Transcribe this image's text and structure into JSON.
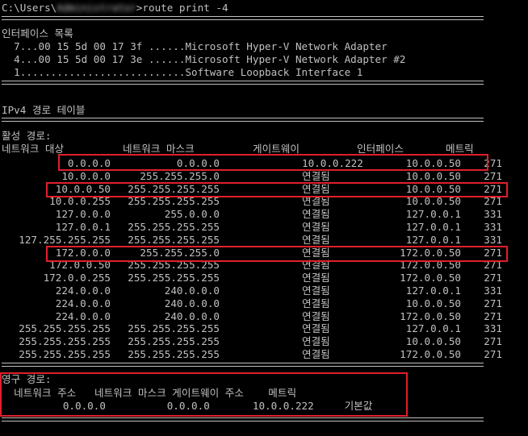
{
  "prompt": {
    "path_prefix": "C:\\Users\\",
    "username": "Administrator",
    "path_suffix": ">",
    "command": "route print -4"
  },
  "interfaces": {
    "title": "인터페이스 목록",
    "items": [
      "  7...00 15 5d 00 17 3f ......Microsoft Hyper-V Network Adapter",
      "  4...00 15 5d 00 17 3e ......Microsoft Hyper-V Network Adapter #2",
      "  1...........................Software Loopback Interface 1"
    ]
  },
  "ipv4_table": {
    "title": "IPv4 경로 테이블",
    "active_label": "활성 경로:",
    "columns": [
      "네트워크 대상",
      "네트워크 마스크",
      "게이트웨이",
      "인터페이스",
      "메트릭"
    ],
    "rows": [
      [
        "0.0.0.0",
        "0.0.0.0",
        "10.0.0.222",
        "10.0.0.50",
        "271"
      ],
      [
        "10.0.0.0",
        "255.255.255.0",
        "연결됨",
        "10.0.0.50",
        "271"
      ],
      [
        "10.0.0.50",
        "255.255.255.255",
        "연결됨",
        "10.0.0.50",
        "271"
      ],
      [
        "10.0.0.255",
        "255.255.255.255",
        "연결됨",
        "10.0.0.50",
        "271"
      ],
      [
        "127.0.0.0",
        "255.0.0.0",
        "연결됨",
        "127.0.0.1",
        "331"
      ],
      [
        "127.0.0.1",
        "255.255.255.255",
        "연결됨",
        "127.0.0.1",
        "331"
      ],
      [
        "127.255.255.255",
        "255.255.255.255",
        "연결됨",
        "127.0.0.1",
        "331"
      ],
      [
        "172.0.0.0",
        "255.255.255.0",
        "연결됨",
        "172.0.0.50",
        "271"
      ],
      [
        "172.0.0.50",
        "255.255.255.255",
        "연결됨",
        "172.0.0.50",
        "271"
      ],
      [
        "172.0.0.255",
        "255.255.255.255",
        "연결됨",
        "172.0.0.50",
        "271"
      ],
      [
        "224.0.0.0",
        "240.0.0.0",
        "연결됨",
        "127.0.0.1",
        "331"
      ],
      [
        "224.0.0.0",
        "240.0.0.0",
        "연결됨",
        "10.0.0.50",
        "271"
      ],
      [
        "224.0.0.0",
        "240.0.0.0",
        "연결됨",
        "172.0.0.50",
        "271"
      ],
      [
        "255.255.255.255",
        "255.255.255.255",
        "연결됨",
        "127.0.0.1",
        "331"
      ],
      [
        "255.255.255.255",
        "255.255.255.255",
        "연결됨",
        "10.0.0.50",
        "271"
      ],
      [
        "255.255.255.255",
        "255.255.255.255",
        "연결됨",
        "172.0.0.50",
        "271"
      ]
    ]
  },
  "persistent": {
    "label": "영구 경로:",
    "header": "  네트워크 주소   네트워크 마스크 게이트웨이 주소    메트릭",
    "row": "          0.0.0.0          0.0.0.0       10.0.0.222     기본값"
  },
  "colors": {
    "background": "#000000",
    "text": "#c0c0c0",
    "highlight": "#e01f2b"
  }
}
